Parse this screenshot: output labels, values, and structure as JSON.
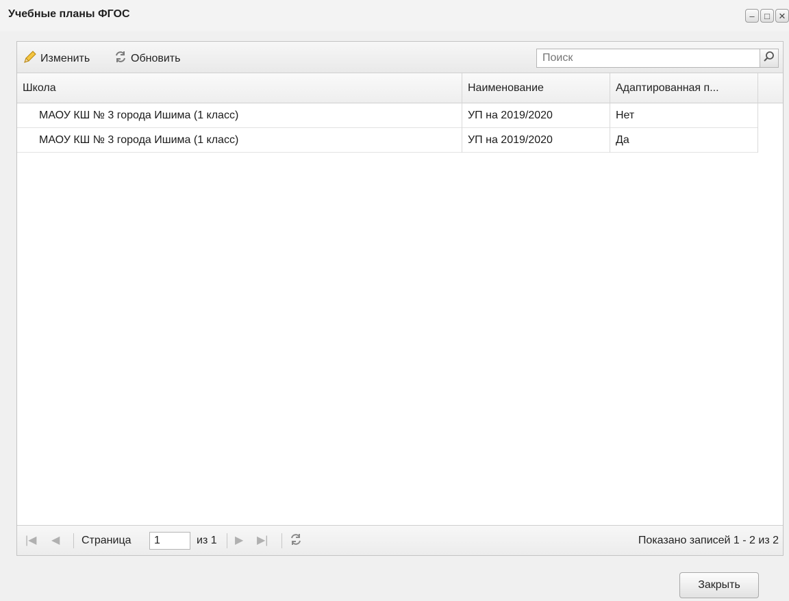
{
  "window": {
    "title": "Учебные планы ФГОС",
    "minimize_glyph": "–",
    "maximize_glyph": "□",
    "close_glyph": "✕"
  },
  "toolbar": {
    "edit_label": "Изменить",
    "edit_icon": "pencil-icon",
    "refresh_label": "Обновить",
    "refresh_icon": "refresh-icon"
  },
  "search": {
    "placeholder": "Поиск",
    "icon": "search-icon"
  },
  "grid": {
    "columns": [
      "Школа",
      "Наименование",
      "Адаптированная п..."
    ],
    "rows": [
      [
        "МАОУ КШ № 3 города Ишима (1 класс)",
        "УП на 2019/2020",
        "Нет"
      ],
      [
        "МАОУ КШ № 3 города Ишима (1 класс)",
        "УП на 2019/2020",
        "Да"
      ]
    ]
  },
  "pager": {
    "page_label": "Страница",
    "page_value": "1",
    "of_label": "из 1",
    "status": "Показано записей 1 - 2 из 2"
  },
  "footer": {
    "close_label": "Закрыть"
  }
}
